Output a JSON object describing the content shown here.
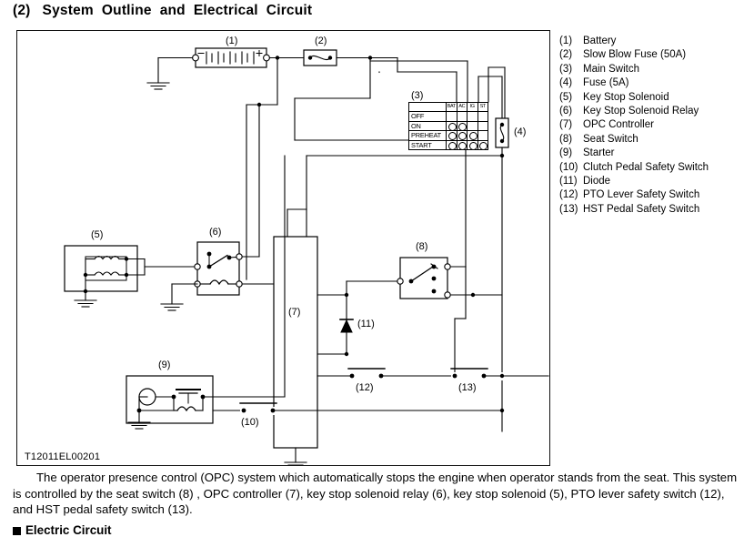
{
  "page": {
    "title_number": "(2)",
    "title_words": [
      "System",
      "Outline",
      "and",
      "Electrical",
      "Circuit"
    ],
    "title_full": "(2)  System Outline and Electrical Circuit"
  },
  "figure": {
    "id": "T12011EL00201",
    "callouts": {
      "c1": "(1)",
      "c2": "(2)",
      "c3": "(3)",
      "c4": "(4)",
      "c5": "(5)",
      "c6": "(6)",
      "c7": "(7)",
      "c8": "(8)",
      "c9": "(9)",
      "c10": "(10)",
      "c11": "(11)",
      "c12": "(12)",
      "c13": "(13)"
    },
    "battery": {
      "minus": "−",
      "plus": "+"
    },
    "main_switch_table": {
      "label": "(3)",
      "terminals": [
        "BAT",
        "AC",
        "IG",
        "ST"
      ],
      "rows": [
        {
          "position": "OFF",
          "contacts": [
            false,
            false,
            false,
            false
          ]
        },
        {
          "position": "ON",
          "contacts": [
            true,
            true,
            false,
            false
          ]
        },
        {
          "position": "PREHEAT",
          "contacts": [
            true,
            true,
            true,
            false
          ]
        },
        {
          "position": "START",
          "contacts": [
            true,
            true,
            true,
            true
          ]
        }
      ]
    }
  },
  "legend": {
    "items": [
      {
        "key": "(1)",
        "label": "Battery"
      },
      {
        "key": "(2)",
        "label": "Slow Blow Fuse (50A)"
      },
      {
        "key": "(3)",
        "label": "Main Switch"
      },
      {
        "key": "(4)",
        "label": "Fuse (5A)"
      },
      {
        "key": "(5)",
        "label": "Key Stop Solenoid"
      },
      {
        "key": "(6)",
        "label": "Key Stop Solenoid Relay"
      },
      {
        "key": "(7)",
        "label": "OPC Controller"
      },
      {
        "key": "(8)",
        "label": "Seat Switch"
      },
      {
        "key": "(9)",
        "label": "Starter"
      },
      {
        "key": "(10)",
        "label": "Clutch Pedal Safety Switch"
      },
      {
        "key": "(11)",
        "label": "Diode"
      },
      {
        "key": "(12)",
        "label": "PTO Lever Safety Switch"
      },
      {
        "key": "(13)",
        "label": "HST Pedal Safety Switch"
      }
    ]
  },
  "body": {
    "paragraph": "The operator presence control (OPC) system which automatically stops the engine when operator stands from the seat.  This system is controlled by the seat switch (8) , OPC controller (7), key stop solenoid relay (6), key stop solenoid (5), PTO lever safety switch (12), and HST pedal safety switch (13).",
    "section_heading": "Electric Circuit"
  },
  "colors": {
    "ink": "#000000",
    "paper": "#ffffff",
    "frame": "#111111"
  }
}
